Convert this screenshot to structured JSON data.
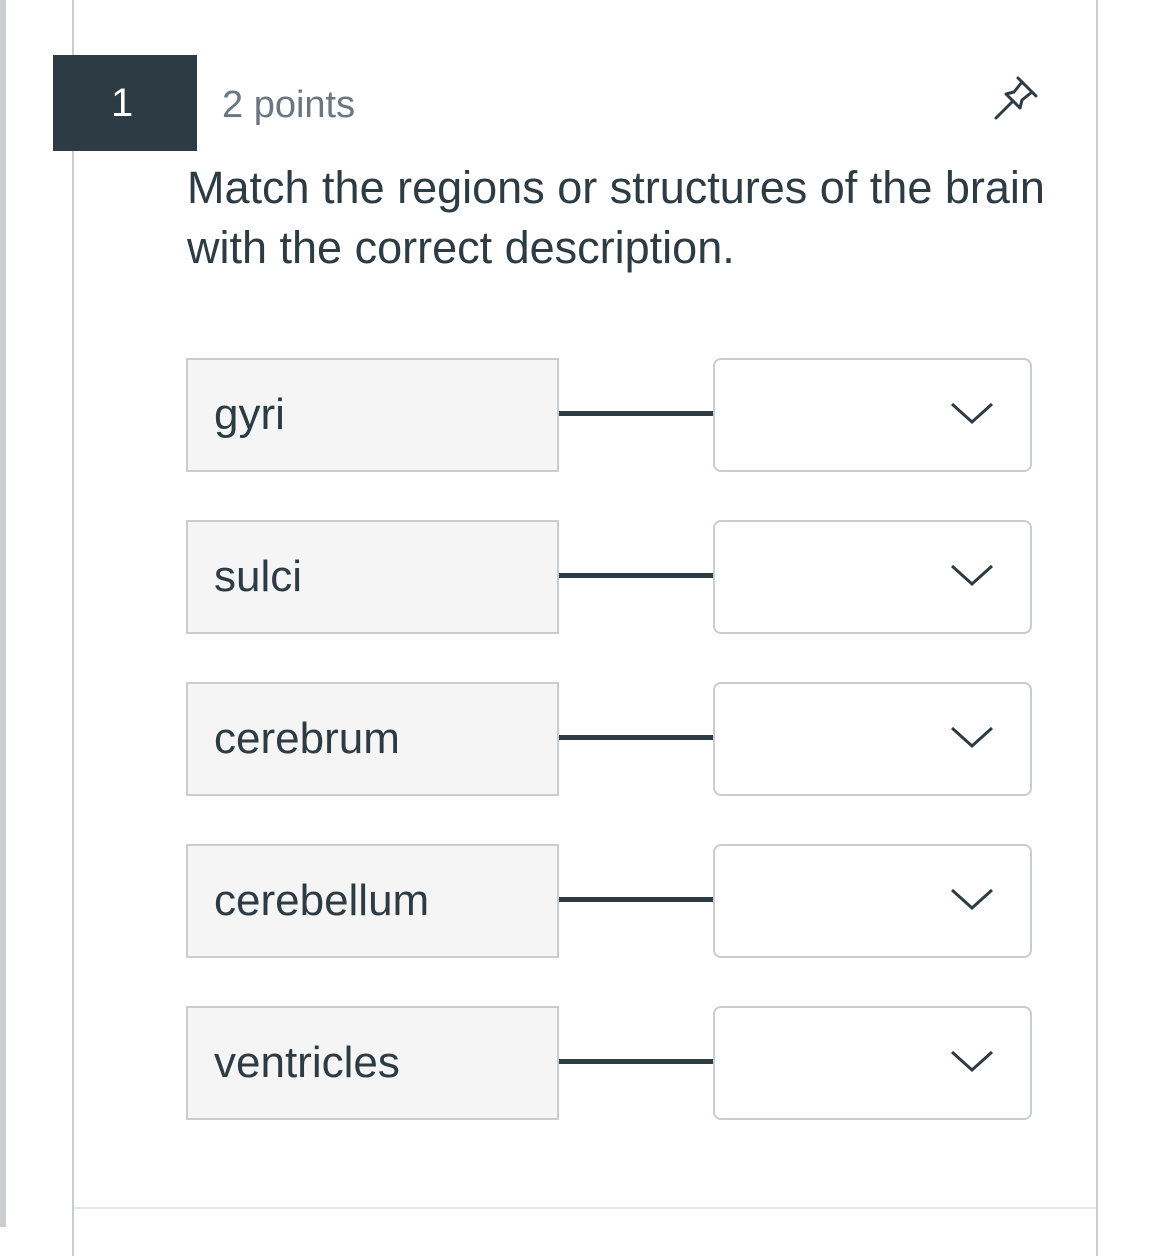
{
  "question": {
    "number": "1",
    "points": "2 points",
    "text": "Match the regions or structures of the brain with the correct description."
  },
  "icons": {
    "pin": "pin-icon",
    "dropdown": "chevron-down-icon"
  },
  "colors": {
    "primary_text": "#2d3b45",
    "number_badge_bg": "#2d3b45",
    "muted_text": "#6b7780",
    "border": "#c7cdd1",
    "term_bg": "#f5f5f5"
  },
  "matches": [
    {
      "term": "gyri",
      "selected": ""
    },
    {
      "term": "sulci",
      "selected": ""
    },
    {
      "term": "cerebrum",
      "selected": ""
    },
    {
      "term": "cerebellum",
      "selected": ""
    },
    {
      "term": "ventricles",
      "selected": ""
    }
  ]
}
